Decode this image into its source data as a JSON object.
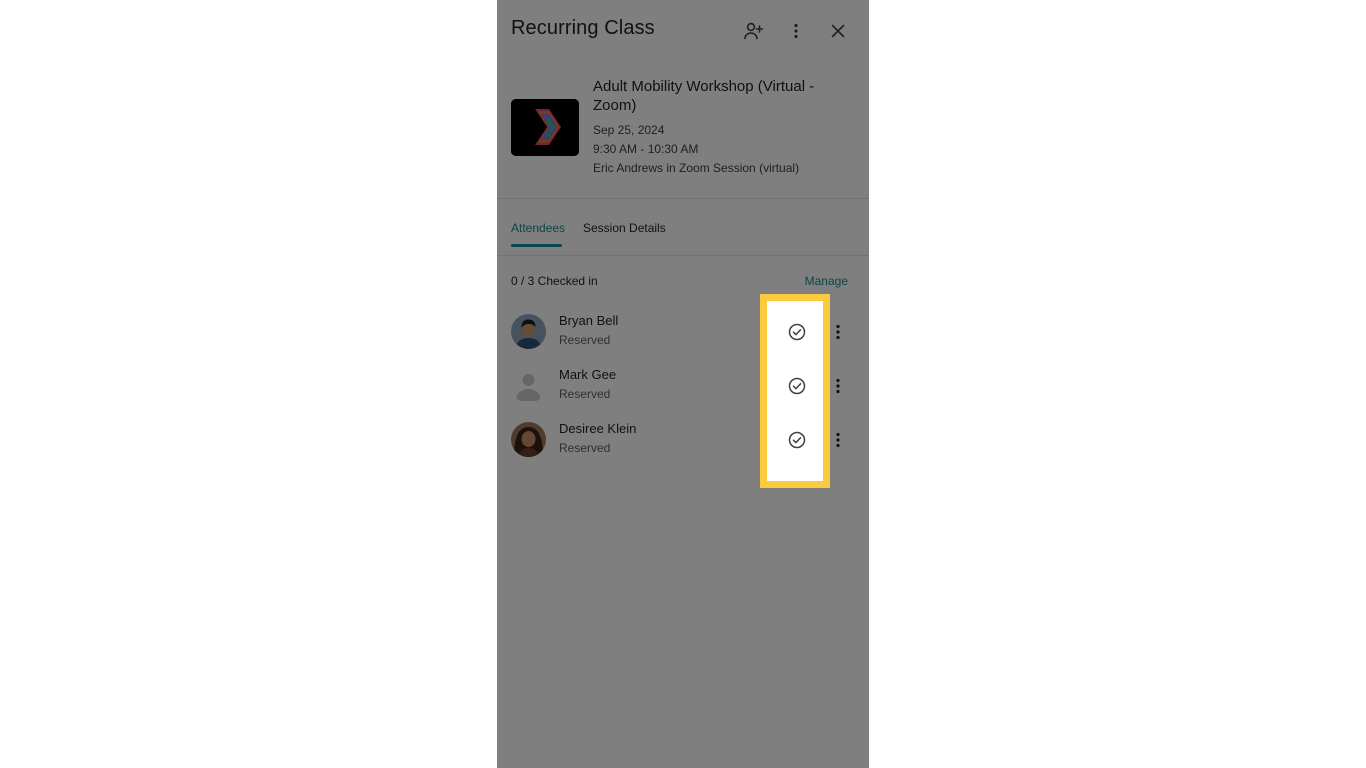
{
  "header": {
    "title": "Recurring Class",
    "icons": [
      "add-person-icon",
      "more-vertical-icon",
      "close-icon"
    ]
  },
  "event": {
    "title": "Adult Mobility Workshop (Virtual - Zoom)",
    "date": "Sep 25, 2024",
    "time": "9:30 AM - 10:30 AM",
    "instructor_location": "Eric Andrews in Zoom Session (virtual)"
  },
  "tabs": [
    {
      "label": "Attendees",
      "active": true
    },
    {
      "label": "Session Details",
      "active": false
    }
  ],
  "attendance": {
    "checked_in_label": "0 / 3 Checked in",
    "manage_label": "Manage"
  },
  "attendees": [
    {
      "name": "Bryan Bell",
      "status": "Reserved",
      "avatar": "photo"
    },
    {
      "name": "Mark Gee",
      "status": "Reserved",
      "avatar": "placeholder-person"
    },
    {
      "name": "Desiree Klein",
      "status": "Reserved",
      "avatar": "photo"
    }
  ],
  "colors": {
    "accent": "#1a8a99",
    "highlight": "#fcca3d",
    "overlay": "rgba(0,0,0,0.5)"
  }
}
